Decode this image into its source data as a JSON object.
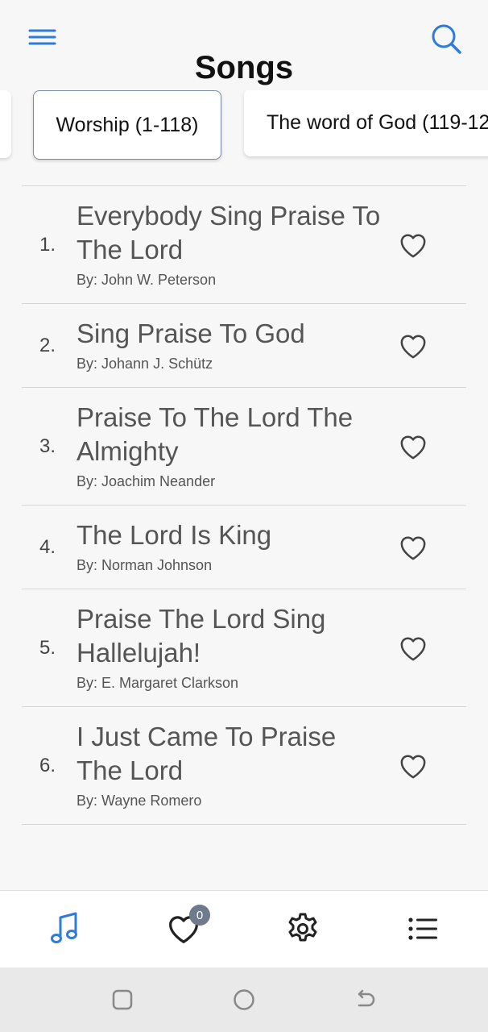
{
  "header": {
    "title": "Songs",
    "menu_icon": "hamburger-menu-icon",
    "search_icon": "search-icon",
    "accent_color": "#2f7bd9"
  },
  "categories": [
    {
      "label": "",
      "active": false
    },
    {
      "label": "Worship (1-118)",
      "active": true
    },
    {
      "label": "The word of God (119-12",
      "active": false
    }
  ],
  "songs": [
    {
      "number": "1.",
      "title": "Everybody Sing Praise To The Lord",
      "author": "By: John W. Peterson"
    },
    {
      "number": "2.",
      "title": "Sing Praise To God",
      "author": "By: Johann J. Schütz"
    },
    {
      "number": "3.",
      "title": "Praise To The Lord The Almighty",
      "author": "By: Joachim Neander"
    },
    {
      "number": "4.",
      "title": "The Lord Is King",
      "author": "By: Norman Johnson"
    },
    {
      "number": "5.",
      "title": "Praise The Lord Sing Hallelujah!",
      "author": "By: E. Margaret Clarkson"
    },
    {
      "number": "6.",
      "title": "I Just Came To Praise The Lord",
      "author": "By: Wayne Romero"
    }
  ],
  "tabbar": {
    "songs_icon": "music-note-icon",
    "favorites_icon": "heart-icon",
    "favorites_badge": "0",
    "settings_icon": "gear-icon",
    "list_icon": "list-icon"
  },
  "system_nav": {
    "recents_icon": "recents-square-icon",
    "home_icon": "home-circle-icon",
    "back_icon": "back-arrow-icon"
  }
}
